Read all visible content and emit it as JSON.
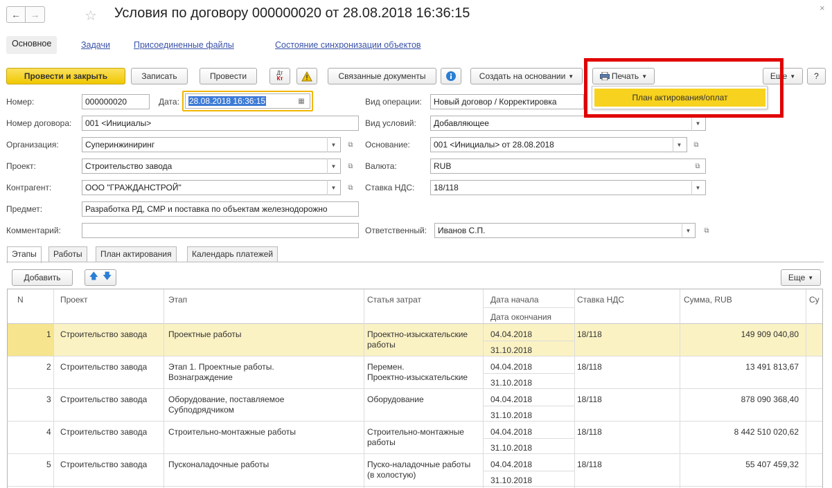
{
  "window": {
    "title": "Условия по договору 000000020 от 28.08.2018 16:36:15",
    "back_icon": "arrow-left",
    "forward_icon": "arrow-right",
    "favorite_icon": "star-outline",
    "close_icon": "close-x"
  },
  "top_tabs": [
    {
      "label": "Основное",
      "active": true
    },
    {
      "label": "Задачи"
    },
    {
      "label": "Присоединенные файлы"
    },
    {
      "label": "Состояние синхронизации объектов"
    }
  ],
  "toolbar": {
    "post_close": "Провести и закрыть",
    "save": "Записать",
    "post": "Провести",
    "dt_label": "Дт",
    "kt_label": "Кт",
    "related_docs": "Связанные документы",
    "create_based": "Создать на основании",
    "print": "Печать",
    "more": "Еще",
    "help": "?"
  },
  "print_menu": {
    "items": [
      "План актирования/оплат"
    ]
  },
  "form": {
    "number_label": "Номер:",
    "number_value": "000000020",
    "date_label": "Дата:",
    "date_value": "28.08.2018 16:36:15",
    "contract_label": "Номер договора:",
    "contract_value": "001 <Инициалы>",
    "org_label": "Организация:",
    "org_value": "Суперинжиниринг",
    "project_label": "Проект:",
    "project_value": "Строительство завода",
    "counterparty_label": "Контрагент:",
    "counterparty_value": "ООО \"ГРАЖДАНСТРОЙ\"",
    "subject_label": "Предмет:",
    "subject_value": "Разработка РД, СМР и поставка по объектам железнодорожно",
    "comment_label": "Комментарий:",
    "comment_value": "",
    "operation_label": "Вид операции:",
    "operation_value": "Новый договор / Корректировка",
    "conditions_label": "Вид условий:",
    "conditions_value": "Добавляющее",
    "basis_label": "Основание:",
    "basis_value": "001 <Инициалы> от 28.08.2018",
    "currency_label": "Валюта:",
    "currency_value": "RUB",
    "vat_label": "Ставка НДС:",
    "vat_value": "18/118",
    "responsible_label": "Ответственный:",
    "responsible_value": "Иванов С.П."
  },
  "lower_tabs": [
    {
      "label": "Этапы",
      "active": true
    },
    {
      "label": "Работы"
    },
    {
      "label": "План актирования"
    },
    {
      "label": "Календарь платежей"
    }
  ],
  "table_toolbar": {
    "add": "Добавить",
    "more": "Еще"
  },
  "table": {
    "headers": {
      "n": "N",
      "project": "Проект",
      "stage": "Этап",
      "cost_item": "Статья затрат",
      "start_date": "Дата начала",
      "end_date": "Дата окончания",
      "vat": "Ставка НДС",
      "sum": "Сумма, RUB",
      "sum2": "Су"
    },
    "rows": [
      {
        "n": "1",
        "project": "Строительство завода",
        "stage1": "Проектные работы",
        "stage2": "",
        "cost1": "Проектно-изыскательские",
        "cost2": "работы",
        "start": "04.04.2018",
        "end": "31.10.2018",
        "vat": "18/118",
        "sum": "149 909 040,80",
        "selected": true
      },
      {
        "n": "2",
        "project": "Строительство завода",
        "stage1": "Этап 1. Проектные работы.",
        "stage2": "Вознаграждение",
        "cost1": "Перемен.",
        "cost2": "Проектно-изыскательские",
        "start": "04.04.2018",
        "end": "31.10.2018",
        "vat": "18/118",
        "sum": "13 491 813,67"
      },
      {
        "n": "3",
        "project": "Строительство завода",
        "stage1": "Оборудование, поставляемое",
        "stage2": "Субподрядчиком",
        "cost1": "Оборудование",
        "cost2": "",
        "start": "04.04.2018",
        "end": "31.10.2018",
        "vat": "18/118",
        "sum": "878 090 368,40"
      },
      {
        "n": "4",
        "project": "Строительство завода",
        "stage1": "Строительно-монтажные работы",
        "stage2": "",
        "cost1": "Строительно-монтажные",
        "cost2": "работы",
        "start": "04.04.2018",
        "end": "31.10.2018",
        "vat": "18/118",
        "sum": "8 442 510 020,62"
      },
      {
        "n": "5",
        "project": "Строительство завода",
        "stage1": "Пусконаладочные работы",
        "stage2": "",
        "cost1": "Пуско-наладочные работы",
        "cost2": "(в холостую)",
        "start": "04.04.2018",
        "end": "31.10.2018",
        "vat": "18/118",
        "sum": "55 407 459,32"
      }
    ]
  },
  "colors": {
    "accent_yellow": "#f7d21e",
    "highlight_red": "#e00000",
    "link_blue": "#3a52a8",
    "selected_row": "#fbf2c4"
  }
}
